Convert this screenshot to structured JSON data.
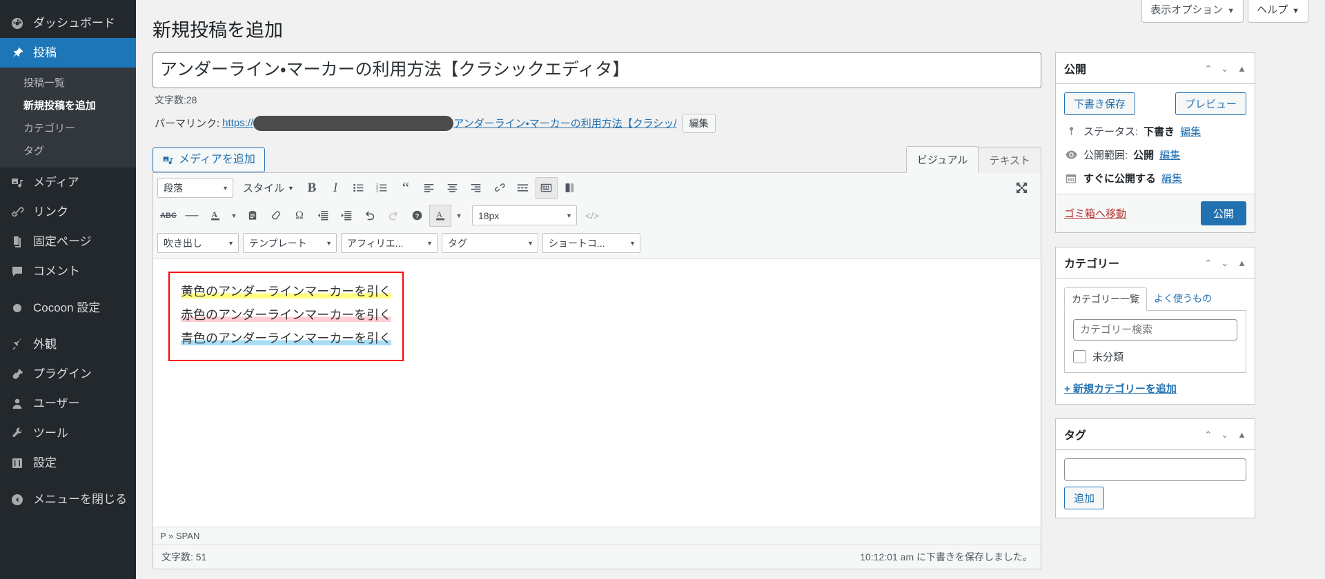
{
  "sidebar": {
    "items": [
      {
        "label": "ダッシュボード",
        "icon": "dashboard-icon"
      },
      {
        "label": "投稿",
        "icon": "pin-icon",
        "current": true
      },
      {
        "label": "メディア",
        "icon": "media-icon"
      },
      {
        "label": "リンク",
        "icon": "link-icon"
      },
      {
        "label": "固定ページ",
        "icon": "pages-icon"
      },
      {
        "label": "コメント",
        "icon": "comment-icon"
      },
      {
        "label": "Cocoon 設定",
        "icon": "cocoon-icon"
      },
      {
        "label": "外観",
        "icon": "appearance-icon"
      },
      {
        "label": "プラグイン",
        "icon": "plugin-icon"
      },
      {
        "label": "ユーザー",
        "icon": "user-icon"
      },
      {
        "label": "ツール",
        "icon": "tools-icon"
      },
      {
        "label": "設定",
        "icon": "settings-icon"
      },
      {
        "label": "メニューを閉じる",
        "icon": "collapse-icon"
      }
    ],
    "submenu": [
      {
        "label": "投稿一覧",
        "active": false
      },
      {
        "label": "新規投稿を追加",
        "active": true
      },
      {
        "label": "カテゴリー",
        "active": false
      },
      {
        "label": "タグ",
        "active": false
      }
    ]
  },
  "screen_meta": {
    "display_options": "表示オプション",
    "help": "ヘルプ",
    "caret": "▼"
  },
  "page": {
    "title": "新規投稿を追加"
  },
  "post": {
    "title_value": "アンダーライン・マーカーの利用方法【クラシックエディタ】",
    "title_charcount": "文字数:28",
    "permalink_label": "パーマリンク:",
    "permalink_scheme": "https://",
    "permalink_slug": "アンダーライン・マーカーの利用方法【クラシッ/",
    "edit_slug_button": "編集"
  },
  "editor": {
    "add_media": "メディアを追加",
    "add_media_icon": "add-media-icon",
    "tab_visual": "ビジュアル",
    "tab_text": "テキスト",
    "toolbar_row1": {
      "format_select": "段落",
      "style_select": "スタイル",
      "buttons": [
        {
          "name": "bold-button",
          "glyph": "B"
        },
        {
          "name": "italic-button",
          "glyph": "I"
        },
        {
          "name": "bulleted-list-button",
          "glyph": "ul"
        },
        {
          "name": "numbered-list-button",
          "glyph": "ol"
        },
        {
          "name": "blockquote-button",
          "glyph": "“"
        },
        {
          "name": "align-left-button",
          "glyph": "al"
        },
        {
          "name": "align-center-button",
          "glyph": "ac"
        },
        {
          "name": "align-right-button",
          "glyph": "ar"
        },
        {
          "name": "insert-link-button",
          "glyph": "link"
        },
        {
          "name": "read-more-button",
          "glyph": "more"
        },
        {
          "name": "toolbar-toggle-button",
          "glyph": "kitchensink",
          "active": true
        },
        {
          "name": "copy-paste-button",
          "glyph": "copy"
        }
      ],
      "fullscreen_button": "fullscreen-icon"
    },
    "toolbar_row2": {
      "font_size": "18px",
      "buttons": [
        {
          "name": "strikethrough-button",
          "glyph": "ABC"
        },
        {
          "name": "horizontal-line-button",
          "glyph": "—"
        },
        {
          "name": "text-color-button",
          "glyph": "A"
        },
        {
          "name": "text-color-dropdown",
          "glyph": "▾"
        },
        {
          "name": "paste-as-text-button",
          "glyph": "clipboard"
        },
        {
          "name": "clear-formatting-button",
          "glyph": "eraser"
        },
        {
          "name": "special-character-button",
          "glyph": "Ω"
        },
        {
          "name": "decrease-indent-button",
          "glyph": "outdent"
        },
        {
          "name": "increase-indent-button",
          "glyph": "indent"
        },
        {
          "name": "undo-button",
          "glyph": "↺"
        },
        {
          "name": "redo-button",
          "glyph": "↻",
          "disabled": true
        },
        {
          "name": "keyboard-shortcuts-button",
          "glyph": "?"
        },
        {
          "name": "highlight-color-button",
          "glyph": "A",
          "active": true
        },
        {
          "name": "highlight-color-dropdown",
          "glyph": "▾"
        },
        {
          "name": "source-code-button",
          "glyph": "</>"
        }
      ]
    },
    "toolbar_row3": [
      {
        "name": "balloon-select",
        "label": "吹き出し"
      },
      {
        "name": "template-select",
        "label": "テンプレート"
      },
      {
        "name": "affiliate-select",
        "label": "アフィリエ..."
      },
      {
        "name": "tag-select",
        "label": "タグ"
      },
      {
        "name": "shortcode-select",
        "label": "ショートコ..."
      }
    ],
    "content_lines": [
      {
        "text": "黄色のアンダーラインマーカーを引く",
        "marker": "yellow"
      },
      {
        "text": "赤色のアンダーラインマーカーを引く",
        "marker": "red"
      },
      {
        "text": "青色のアンダーラインマーカーを引く",
        "marker": "blue"
      }
    ],
    "path": "P » SPAN",
    "word_count": "文字数: 51",
    "save_status": "10:12:01 am に下書きを保存しました。"
  },
  "publish_box": {
    "title": "公開",
    "save_draft": "下書き保存",
    "preview": "プレビュー",
    "status_label": "ステータス:",
    "status_value": "下書き",
    "status_edit": "編集",
    "visibility_label": "公開範囲:",
    "visibility_value": "公開",
    "visibility_edit": "編集",
    "schedule_value": "すぐに公開する",
    "schedule_edit": "編集",
    "trash": "ゴミ箱へ移動",
    "publish": "公開"
  },
  "category_box": {
    "title": "カテゴリー",
    "tab_all": "カテゴリー一覧",
    "tab_frequent": "よく使うもの",
    "search_placeholder": "カテゴリー検索",
    "items": [
      "未分類"
    ],
    "add_new": "+ 新規カテゴリーを追加"
  },
  "tag_box": {
    "title": "タグ",
    "input_value": "",
    "add_button": "追加"
  },
  "colors": {
    "admin_bg": "#23282d",
    "accent": "#2271b1",
    "current_menu": "#1d76b8",
    "marker_yellow": "#ffff7f",
    "marker_red": "#ffcdd2",
    "marker_blue": "#a8dcf5",
    "redbox_border": "#ff0000"
  },
  "box_controls": {
    "up": "⌃",
    "down": "⌄",
    "toggle": "▲"
  }
}
